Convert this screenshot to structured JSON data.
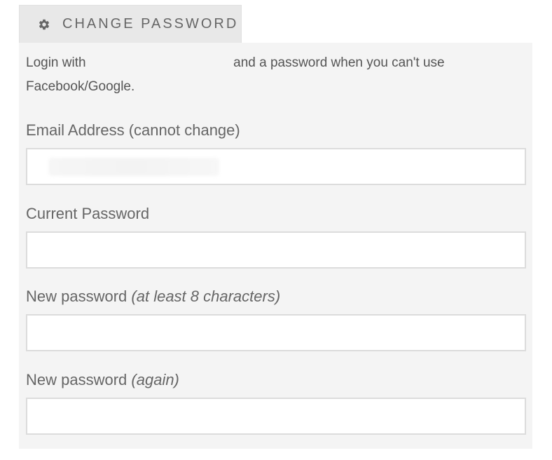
{
  "tab": {
    "icon": "gear-icon",
    "label": "CHANGE PASSWORD"
  },
  "intro": {
    "line1_start": "Login with",
    "line1_end": "and a password when you can't use",
    "line2": "Facebook/Google."
  },
  "fields": {
    "email": {
      "label": "Email Address (cannot change)",
      "value": ""
    },
    "current_password": {
      "label": "Current Password",
      "value": ""
    },
    "new_password": {
      "label": "New password",
      "hint": "(at least 8 characters)",
      "value": ""
    },
    "confirm_password": {
      "label": "New password",
      "hint": "(again)",
      "value": ""
    }
  },
  "colors": {
    "tab_background": "#e8e8e8",
    "panel_background": "#f4f4f4",
    "input_border": "#dcdcdc",
    "text": "#666666"
  }
}
